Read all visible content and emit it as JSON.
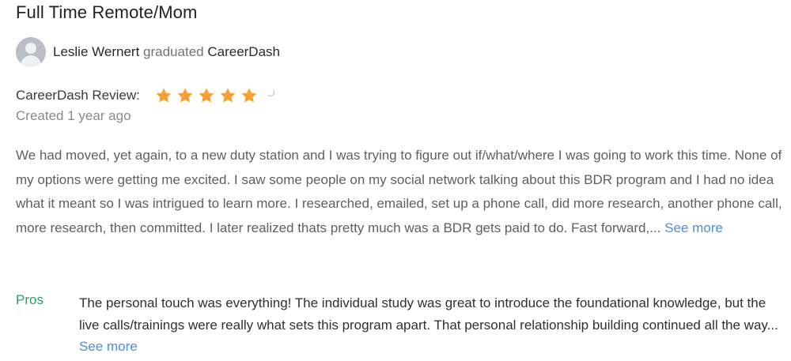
{
  "review": {
    "title": "Full Time Remote/Mom",
    "author_name": "Leslie Wernert",
    "graduated_word": "graduated",
    "school_name": "CareerDash",
    "review_label": "CareerDash Review:",
    "rating": 5,
    "rating_max": 5,
    "created": "Created 1 year ago",
    "body": "We had moved, yet again, to a new duty station and I was trying to figure out if/what/where I was going to work this time. None of my options were getting me excited. I saw some people on my social network talking about this BDR program and I had no idea what it meant so I was intrigued to learn more. I researched, emailed, set up a phone call, did more research, another phone call, more research, then committed. I later realized thats pretty much was a BDR gets paid to do. Fast forward,...",
    "see_more_label": "See more",
    "pros_label": "Pros",
    "pros_text": "The personal touch was everything! The individual study was great to introduce the foundational knowledge, but the live calls/trainings were really what sets this program apart. That personal relationship building continued all the way...",
    "pros_see_more_label": "See more"
  },
  "colors": {
    "star": "#f5a133",
    "link": "#4a90d9",
    "pros": "#2e9e62"
  },
  "icons": {
    "avatar": "user-avatar-icon",
    "star": "star-icon",
    "loading": "loading-spinner-icon"
  }
}
